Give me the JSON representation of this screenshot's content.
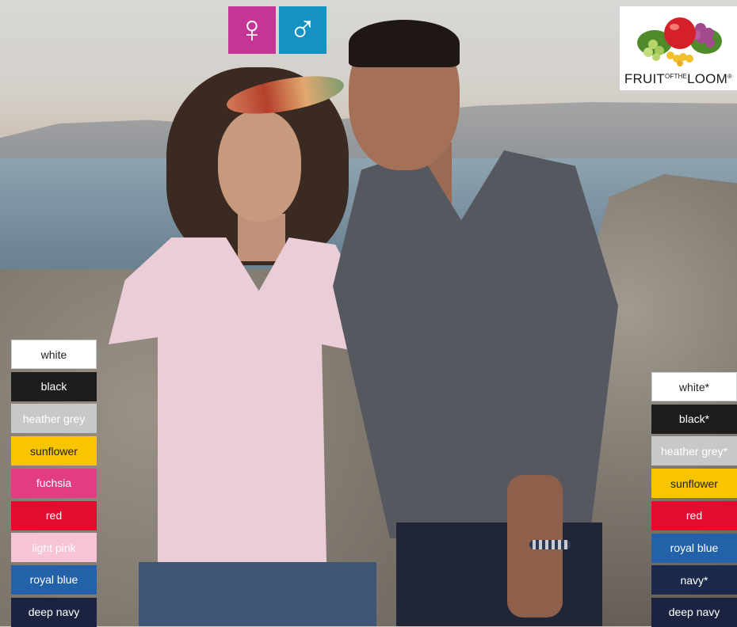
{
  "gender_icons": {
    "female": "♀",
    "male": "♂"
  },
  "logo": {
    "brand_left": "FRUIT",
    "brand_of": "OF",
    "brand_the": "THE",
    "brand_right": "LOOM",
    "registered": "®"
  },
  "left_colors": [
    {
      "label": "white",
      "bg": "#ffffff",
      "fg": "#222222"
    },
    {
      "label": "black",
      "bg": "#1d1d1b",
      "fg": "#ffffff"
    },
    {
      "label": "heather grey",
      "bg": "#c7c8ca",
      "fg": "#ffffff"
    },
    {
      "label": "sunflower",
      "bg": "#f9c400",
      "fg": "#222222"
    },
    {
      "label": "fuchsia",
      "bg": "#e33c82",
      "fg": "#ffffff"
    },
    {
      "label": "red",
      "bg": "#e30b2e",
      "fg": "#ffffff"
    },
    {
      "label": "light pink",
      "bg": "#f6c3d7",
      "fg": "#ffffff"
    },
    {
      "label": "royal blue",
      "bg": "#2361a8",
      "fg": "#ffffff"
    },
    {
      "label": "deep navy",
      "bg": "#1c2340",
      "fg": "#ffffff"
    }
  ],
  "right_colors": [
    {
      "label": "white*",
      "bg": "#ffffff",
      "fg": "#222222"
    },
    {
      "label": "black*",
      "bg": "#1d1d1b",
      "fg": "#ffffff"
    },
    {
      "label": "heather grey*",
      "bg": "#c7c8ca",
      "fg": "#ffffff"
    },
    {
      "label": "sunflower",
      "bg": "#f9c400",
      "fg": "#222222"
    },
    {
      "label": "red",
      "bg": "#e30b2e",
      "fg": "#ffffff"
    },
    {
      "label": "royal blue",
      "bg": "#2361a8",
      "fg": "#ffffff"
    },
    {
      "label": "navy*",
      "bg": "#1b2a4c",
      "fg": "#ffffff"
    },
    {
      "label": "deep navy",
      "bg": "#1c2340",
      "fg": "#ffffff"
    }
  ]
}
